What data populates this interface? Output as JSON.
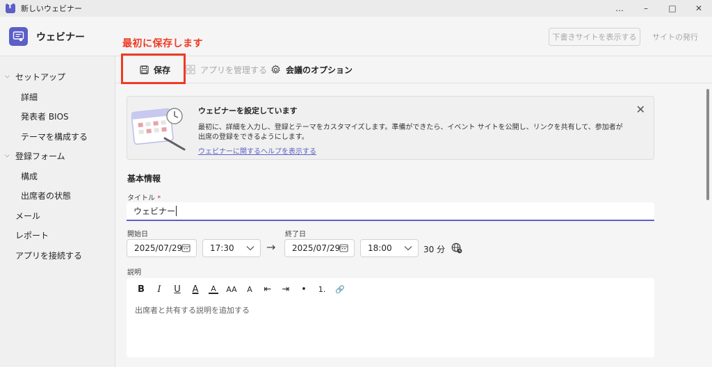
{
  "window": {
    "title": "新しいウェビナー",
    "controls": [
      "…",
      "–",
      "□",
      "✕"
    ]
  },
  "header": {
    "title": "ウェビナー",
    "draft_button": "下書きサイトを表示する",
    "publish_button": "サイトの発行"
  },
  "annotation": {
    "text": "最初に保存します",
    "color": "#ef3a24"
  },
  "sidebar": {
    "items": [
      {
        "label": "セットアップ",
        "icon": "chevron-down-icon"
      },
      {
        "label": "詳細"
      },
      {
        "label": "発表者 BIOS"
      },
      {
        "label": "テーマを構成する"
      },
      {
        "label": "登録フォーム",
        "icon": "chevron-down-icon"
      },
      {
        "label": "構成"
      },
      {
        "label": "出席者の状態"
      },
      {
        "label": "メール"
      },
      {
        "label": "レポート"
      },
      {
        "label": "アプリを接続する"
      }
    ]
  },
  "toolbar": {
    "save": "保存",
    "manage_apps": "アプリを管理する",
    "meeting_options": "会議のオプション"
  },
  "banner": {
    "title": "ウェビナーを設定しています",
    "body": "最初に、詳細を入力し、登録とテーマをカスタマイズします。準備ができたら、イベント サイトを公開し、リンクを共有して、参加者が出席の登録をできるようにします。",
    "link": "ウェビナーに関するヘルプを表示する",
    "close": "✕"
  },
  "form": {
    "section": "基本情報",
    "title_label": "タイトル",
    "required_mark": "*",
    "title_value": "ウェビナー",
    "start_label": "開始日",
    "end_label": "終了日",
    "start_date": "2025/07/29",
    "start_time": "17:30",
    "end_date": "2025/07/29",
    "end_time": "18:00",
    "duration": "30 分",
    "arrow": "→",
    "description_label": "説明",
    "description_placeholder": "出席者と共有する説明を追加する"
  },
  "editor_tools": [
    "B",
    "I",
    "U",
    "A",
    "A",
    "AA",
    "A",
    "⇤",
    "⇥",
    "•",
    "1.",
    "🔗"
  ],
  "colors": {
    "accent": "#5b5fc7",
    "annotation": "#ef3a24"
  }
}
